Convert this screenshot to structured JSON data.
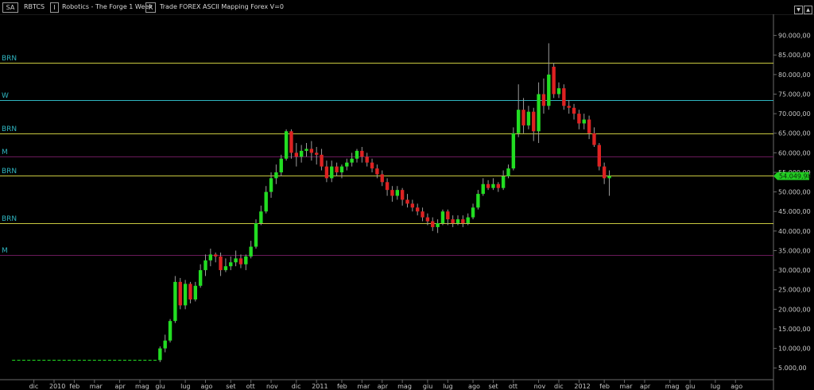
{
  "toolbar": {
    "symbol_box": "SA",
    "symbol": "RBTCS",
    "title": "Robotics - The Forge  1 Week",
    "extra": "Trade  FOREX  ASCII Mapping  Forex  V=0",
    "period_box": "I",
    "range_box": "R"
  },
  "colors": {
    "up": "#22dd22",
    "down": "#dd2222",
    "yellow_line": "#c8c840",
    "cyan_line": "#2fb5c0",
    "magenta_line": "#6a1a5a",
    "last_price_bg": "#22cc22"
  },
  "chart_data": {
    "type": "candlestick",
    "last_price": "54.049,98",
    "ylim": [
      2000,
      95000
    ],
    "y_ticks": [
      "5.000,00",
      "10.000,00",
      "15.000,00",
      "20.000,00",
      "25.000,00",
      "30.000,00",
      "35.000,00",
      "40.000,00",
      "45.000,00",
      "50.000,00",
      "55.000,00",
      "60.000,00",
      "65.000,00",
      "70.000,00",
      "75.000,00",
      "80.000,00",
      "85.000,00",
      "90.000,00"
    ],
    "y_tick_values": [
      5000,
      10000,
      15000,
      20000,
      25000,
      30000,
      35000,
      40000,
      45000,
      50000,
      55000,
      60000,
      65000,
      70000,
      75000,
      80000,
      85000,
      90000
    ],
    "x_labels": [
      "dic",
      "2010",
      "feb",
      "mar",
      "apr",
      "mag",
      "giu",
      "lug",
      "ago",
      "set",
      "ott",
      "nov",
      "dic",
      "2011",
      "feb",
      "mar",
      "apr",
      "mag",
      "giu",
      "lug",
      "ago",
      "set",
      "ott",
      "nov",
      "dic",
      "2012",
      "feb",
      "mar",
      "apr",
      "mag",
      "giu",
      "lug",
      "ago"
    ],
    "x_label_weeks": [
      -4,
      0,
      4,
      8,
      13,
      17,
      21,
      26,
      30,
      35,
      39,
      43,
      48,
      52,
      57,
      61,
      65,
      69,
      74,
      78,
      83,
      87,
      91,
      96,
      100,
      104,
      109,
      113,
      117,
      122,
      126,
      131,
      135
    ],
    "levels": [
      {
        "label": "BRN",
        "value": 83000,
        "kind": "yellow"
      },
      {
        "label": "W",
        "value": 73500,
        "kind": "cyan"
      },
      {
        "label": "BRN",
        "value": 65000,
        "kind": "yellow"
      },
      {
        "label": "M",
        "value": 59000,
        "kind": "magenta"
      },
      {
        "label": "BRN",
        "value": 54100,
        "kind": "yellow"
      },
      {
        "label": "BRN",
        "value": 42000,
        "kind": "yellow"
      },
      {
        "label": "M",
        "value": 33800,
        "kind": "magenta"
      }
    ],
    "flat": {
      "from_week": -8,
      "to_week": 20,
      "value": 7000
    },
    "candles": [
      [
        21,
        7000,
        10000,
        6500,
        10500
      ],
      [
        22,
        10000,
        12000,
        9000,
        13500
      ],
      [
        23,
        12000,
        17000,
        11500,
        17500
      ],
      [
        24,
        17000,
        27000,
        16500,
        28500
      ],
      [
        25,
        27000,
        21000,
        20000,
        28000
      ],
      [
        26,
        21000,
        26500,
        20000,
        27500
      ],
      [
        27,
        26500,
        22500,
        21500,
        27000
      ],
      [
        28,
        22500,
        26000,
        22000,
        27000
      ],
      [
        29,
        26000,
        30000,
        25500,
        31500
      ],
      [
        30,
        30000,
        32500,
        28500,
        34000
      ],
      [
        31,
        32500,
        34000,
        31000,
        35500
      ],
      [
        32,
        34000,
        33500,
        32000,
        34500
      ],
      [
        33,
        33500,
        30000,
        28500,
        34500
      ],
      [
        34,
        30000,
        31000,
        29500,
        33000
      ],
      [
        35,
        31000,
        32000,
        30000,
        33500
      ],
      [
        36,
        32000,
        33000,
        31000,
        35000
      ],
      [
        37,
        33000,
        31500,
        30500,
        34000
      ],
      [
        38,
        31500,
        33500,
        30000,
        34000
      ],
      [
        39,
        33500,
        36000,
        33000,
        37500
      ],
      [
        40,
        36000,
        42000,
        35500,
        43000
      ],
      [
        41,
        42000,
        45000,
        41500,
        46500
      ],
      [
        42,
        45000,
        50000,
        44500,
        51500
      ],
      [
        43,
        50000,
        53500,
        48500,
        55000
      ],
      [
        44,
        53500,
        55000,
        52000,
        57000
      ],
      [
        45,
        55000,
        58500,
        54000,
        59500
      ],
      [
        46,
        58500,
        65500,
        58000,
        66000
      ],
      [
        47,
        65500,
        60000,
        58500,
        66000
      ],
      [
        48,
        60000,
        59000,
        56500,
        62500
      ],
      [
        49,
        59000,
        60500,
        57500,
        62000
      ],
      [
        50,
        60500,
        61000,
        59000,
        62500
      ],
      [
        51,
        61000,
        60000,
        58000,
        63000
      ],
      [
        52,
        60000,
        59500,
        57000,
        61500
      ],
      [
        53,
        59500,
        56500,
        55500,
        61000
      ],
      [
        54,
        56500,
        53500,
        52500,
        58000
      ],
      [
        55,
        53500,
        56500,
        52500,
        58000
      ],
      [
        56,
        56500,
        55000,
        54000,
        57500
      ],
      [
        57,
        55000,
        56500,
        53500,
        57000
      ],
      [
        58,
        56500,
        57500,
        55500,
        58500
      ],
      [
        59,
        57500,
        58500,
        56500,
        60000
      ],
      [
        60,
        58500,
        60500,
        57500,
        61000
      ],
      [
        61,
        60500,
        59000,
        57500,
        61500
      ],
      [
        62,
        59000,
        57500,
        56500,
        60000
      ],
      [
        63,
        57500,
        56000,
        55000,
        58500
      ],
      [
        64,
        56000,
        54500,
        53500,
        57000
      ],
      [
        65,
        54500,
        52500,
        51500,
        55500
      ],
      [
        66,
        52500,
        50500,
        49000,
        53500
      ],
      [
        67,
        50500,
        49000,
        47500,
        51500
      ],
      [
        68,
        49000,
        50500,
        48000,
        51500
      ],
      [
        69,
        50500,
        48000,
        46500,
        51000
      ],
      [
        70,
        48000,
        47000,
        46000,
        49500
      ],
      [
        71,
        47000,
        46000,
        45000,
        48000
      ],
      [
        72,
        46000,
        45000,
        44000,
        47000
      ],
      [
        73,
        45000,
        43500,
        42500,
        46000
      ],
      [
        74,
        43500,
        42500,
        41500,
        44500
      ],
      [
        75,
        42500,
        41000,
        40000,
        43500
      ],
      [
        76,
        41000,
        42000,
        39500,
        43000
      ],
      [
        77,
        42000,
        45000,
        41500,
        45500
      ],
      [
        78,
        45000,
        43000,
        41500,
        45500
      ],
      [
        79,
        43000,
        42000,
        41000,
        44000
      ],
      [
        80,
        42000,
        43000,
        41500,
        44000
      ],
      [
        81,
        43000,
        42000,
        41000,
        44000
      ],
      [
        82,
        42000,
        43500,
        41500,
        44500
      ],
      [
        83,
        43500,
        46000,
        43000,
        47000
      ],
      [
        84,
        46000,
        49500,
        45500,
        50500
      ],
      [
        85,
        49500,
        52000,
        49000,
        53500
      ],
      [
        86,
        52000,
        51000,
        50500,
        53000
      ],
      [
        87,
        51000,
        52000,
        50500,
        53500
      ],
      [
        88,
        52000,
        51000,
        50000,
        52500
      ],
      [
        89,
        51000,
        54000,
        50500,
        55500
      ],
      [
        90,
        54000,
        56000,
        53500,
        57000
      ],
      [
        91,
        56000,
        65000,
        55500,
        66500
      ],
      [
        92,
        65000,
        71000,
        64000,
        77500
      ],
      [
        93,
        71000,
        67000,
        65000,
        74000
      ],
      [
        94,
        67000,
        70500,
        66000,
        72000
      ],
      [
        95,
        70500,
        65500,
        63000,
        71500
      ],
      [
        96,
        65500,
        75000,
        62500,
        78000
      ],
      [
        97,
        75000,
        72000,
        70000,
        79000
      ],
      [
        98,
        72000,
        80000,
        71000,
        88000
      ],
      [
        99,
        82000,
        75000,
        74000,
        83000
      ],
      [
        100,
        75000,
        76500,
        74000,
        78000
      ],
      [
        101,
        76500,
        72000,
        71000,
        77500
      ],
      [
        102,
        72000,
        71500,
        70000,
        73500
      ],
      [
        103,
        71500,
        70000,
        68500,
        72500
      ],
      [
        104,
        70000,
        67500,
        66000,
        71000
      ],
      [
        105,
        67500,
        68500,
        66000,
        70000
      ],
      [
        106,
        68500,
        65000,
        63500,
        69500
      ],
      [
        107,
        65000,
        62000,
        61500,
        66500
      ],
      [
        108,
        62000,
        56500,
        55500,
        62500
      ],
      [
        109,
        56500,
        53500,
        52000,
        57500
      ],
      [
        110,
        53500,
        54050,
        49000,
        55500
      ]
    ]
  }
}
